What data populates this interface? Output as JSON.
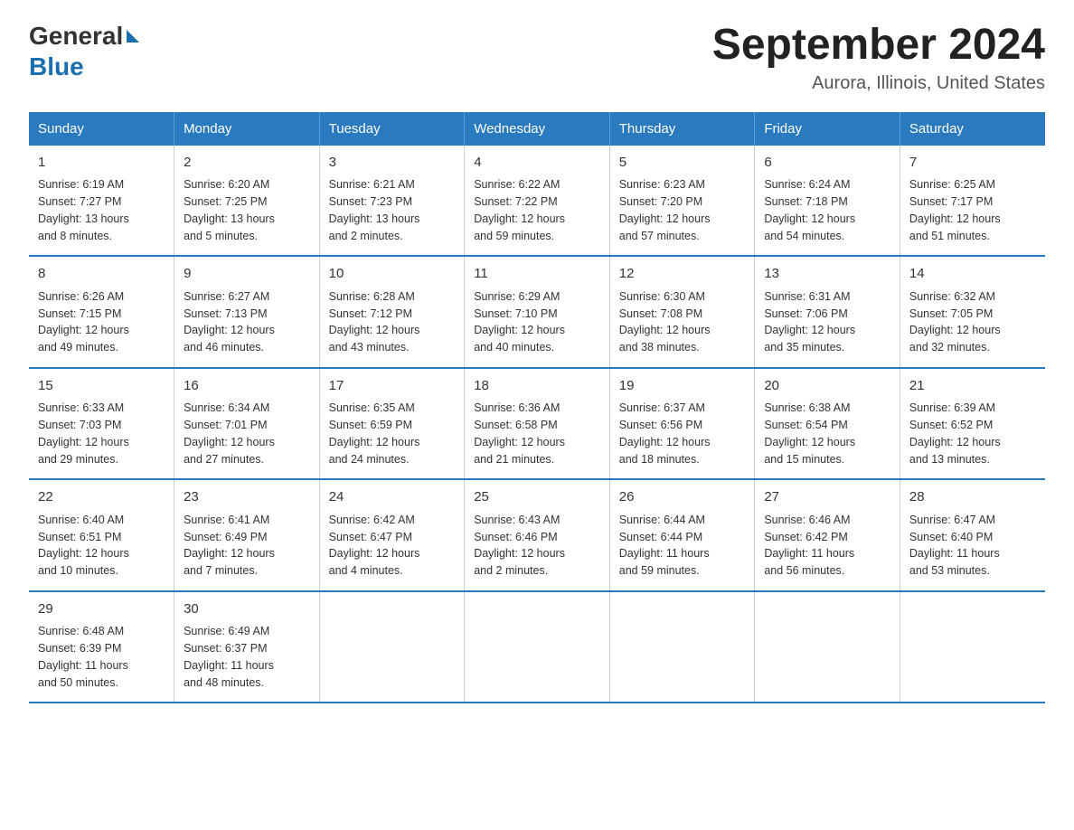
{
  "logo": {
    "text_general": "General",
    "text_blue": "Blue"
  },
  "header": {
    "title": "September 2024",
    "subtitle": "Aurora, Illinois, United States"
  },
  "days_of_week": [
    "Sunday",
    "Monday",
    "Tuesday",
    "Wednesday",
    "Thursday",
    "Friday",
    "Saturday"
  ],
  "weeks": [
    [
      {
        "day": "1",
        "sunrise": "6:19 AM",
        "sunset": "7:27 PM",
        "daylight": "13 hours and 8 minutes."
      },
      {
        "day": "2",
        "sunrise": "6:20 AM",
        "sunset": "7:25 PM",
        "daylight": "13 hours and 5 minutes."
      },
      {
        "day": "3",
        "sunrise": "6:21 AM",
        "sunset": "7:23 PM",
        "daylight": "13 hours and 2 minutes."
      },
      {
        "day": "4",
        "sunrise": "6:22 AM",
        "sunset": "7:22 PM",
        "daylight": "12 hours and 59 minutes."
      },
      {
        "day": "5",
        "sunrise": "6:23 AM",
        "sunset": "7:20 PM",
        "daylight": "12 hours and 57 minutes."
      },
      {
        "day": "6",
        "sunrise": "6:24 AM",
        "sunset": "7:18 PM",
        "daylight": "12 hours and 54 minutes."
      },
      {
        "day": "7",
        "sunrise": "6:25 AM",
        "sunset": "7:17 PM",
        "daylight": "12 hours and 51 minutes."
      }
    ],
    [
      {
        "day": "8",
        "sunrise": "6:26 AM",
        "sunset": "7:15 PM",
        "daylight": "12 hours and 49 minutes."
      },
      {
        "day": "9",
        "sunrise": "6:27 AM",
        "sunset": "7:13 PM",
        "daylight": "12 hours and 46 minutes."
      },
      {
        "day": "10",
        "sunrise": "6:28 AM",
        "sunset": "7:12 PM",
        "daylight": "12 hours and 43 minutes."
      },
      {
        "day": "11",
        "sunrise": "6:29 AM",
        "sunset": "7:10 PM",
        "daylight": "12 hours and 40 minutes."
      },
      {
        "day": "12",
        "sunrise": "6:30 AM",
        "sunset": "7:08 PM",
        "daylight": "12 hours and 38 minutes."
      },
      {
        "day": "13",
        "sunrise": "6:31 AM",
        "sunset": "7:06 PM",
        "daylight": "12 hours and 35 minutes."
      },
      {
        "day": "14",
        "sunrise": "6:32 AM",
        "sunset": "7:05 PM",
        "daylight": "12 hours and 32 minutes."
      }
    ],
    [
      {
        "day": "15",
        "sunrise": "6:33 AM",
        "sunset": "7:03 PM",
        "daylight": "12 hours and 29 minutes."
      },
      {
        "day": "16",
        "sunrise": "6:34 AM",
        "sunset": "7:01 PM",
        "daylight": "12 hours and 27 minutes."
      },
      {
        "day": "17",
        "sunrise": "6:35 AM",
        "sunset": "6:59 PM",
        "daylight": "12 hours and 24 minutes."
      },
      {
        "day": "18",
        "sunrise": "6:36 AM",
        "sunset": "6:58 PM",
        "daylight": "12 hours and 21 minutes."
      },
      {
        "day": "19",
        "sunrise": "6:37 AM",
        "sunset": "6:56 PM",
        "daylight": "12 hours and 18 minutes."
      },
      {
        "day": "20",
        "sunrise": "6:38 AM",
        "sunset": "6:54 PM",
        "daylight": "12 hours and 15 minutes."
      },
      {
        "day": "21",
        "sunrise": "6:39 AM",
        "sunset": "6:52 PM",
        "daylight": "12 hours and 13 minutes."
      }
    ],
    [
      {
        "day": "22",
        "sunrise": "6:40 AM",
        "sunset": "6:51 PM",
        "daylight": "12 hours and 10 minutes."
      },
      {
        "day": "23",
        "sunrise": "6:41 AM",
        "sunset": "6:49 PM",
        "daylight": "12 hours and 7 minutes."
      },
      {
        "day": "24",
        "sunrise": "6:42 AM",
        "sunset": "6:47 PM",
        "daylight": "12 hours and 4 minutes."
      },
      {
        "day": "25",
        "sunrise": "6:43 AM",
        "sunset": "6:46 PM",
        "daylight": "12 hours and 2 minutes."
      },
      {
        "day": "26",
        "sunrise": "6:44 AM",
        "sunset": "6:44 PM",
        "daylight": "11 hours and 59 minutes."
      },
      {
        "day": "27",
        "sunrise": "6:46 AM",
        "sunset": "6:42 PM",
        "daylight": "11 hours and 56 minutes."
      },
      {
        "day": "28",
        "sunrise": "6:47 AM",
        "sunset": "6:40 PM",
        "daylight": "11 hours and 53 minutes."
      }
    ],
    [
      {
        "day": "29",
        "sunrise": "6:48 AM",
        "sunset": "6:39 PM",
        "daylight": "11 hours and 50 minutes."
      },
      {
        "day": "30",
        "sunrise": "6:49 AM",
        "sunset": "6:37 PM",
        "daylight": "11 hours and 48 minutes."
      },
      null,
      null,
      null,
      null,
      null
    ]
  ],
  "labels": {
    "sunrise": "Sunrise:",
    "sunset": "Sunset:",
    "daylight": "Daylight:"
  }
}
